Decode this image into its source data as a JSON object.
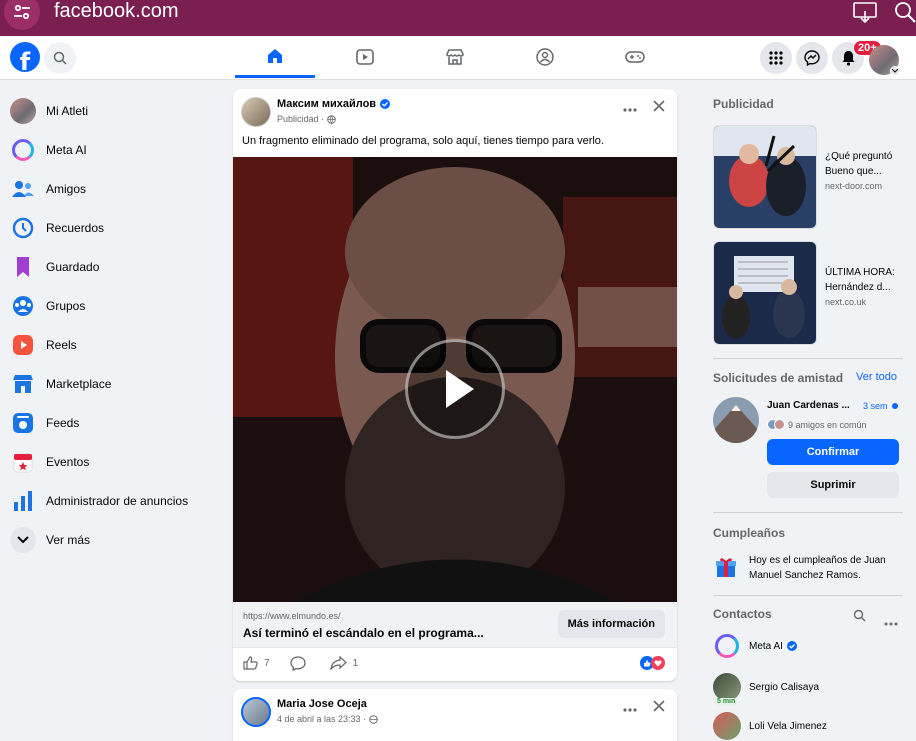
{
  "browser": {
    "url": "facebook.com",
    "icons": [
      "site-settings-icon",
      "cast-icon",
      "zoom-icon"
    ]
  },
  "header": {
    "logo_letter": "f",
    "nav_tabs": [
      {
        "name": "home",
        "icon": "home-icon",
        "active": true
      },
      {
        "name": "reels",
        "icon": "reels-icon",
        "active": false
      },
      {
        "name": "marketplace",
        "icon": "marketplace-icon",
        "active": false
      },
      {
        "name": "groups",
        "icon": "groups-icon",
        "active": false
      },
      {
        "name": "gaming",
        "icon": "gaming-icon",
        "active": false
      }
    ],
    "notifications_badge": "20+"
  },
  "sidebar": {
    "items": [
      {
        "label": "Mi Atleti",
        "icon": "profile-avatar-icon"
      },
      {
        "label": "Meta AI",
        "icon": "meta-ai-icon"
      },
      {
        "label": "Amigos",
        "icon": "friends-icon"
      },
      {
        "label": "Recuerdos",
        "icon": "memories-icon"
      },
      {
        "label": "Guardado",
        "icon": "saved-icon"
      },
      {
        "label": "Grupos",
        "icon": "groups-icon"
      },
      {
        "label": "Reels",
        "icon": "reels-icon"
      },
      {
        "label": "Marketplace",
        "icon": "marketplace-icon"
      },
      {
        "label": "Feeds",
        "icon": "feeds-icon"
      },
      {
        "label": "Eventos",
        "icon": "events-icon"
      },
      {
        "label": "Administrador de anuncios",
        "icon": "ads-manager-icon"
      },
      {
        "label": "Ver más",
        "icon": "chevron-down-icon"
      }
    ]
  },
  "post1": {
    "author": "Максим михайлов",
    "sub": "Publicidad ·",
    "text": "Un fragmento eliminado del programa, solo aquí, tienes tiempo para verlo.",
    "link_domain": "https://www.elmundo.es/",
    "link_title": "Así terminó el escándalo en el programa...",
    "cta": "Más información",
    "likes": "7",
    "shares": "1"
  },
  "post2": {
    "author": "Maria Jose Oceja",
    "sub": "4 de abril a las 23:33 ·"
  },
  "right": {
    "ads_heading": "Publicidad",
    "ads": [
      {
        "title": "¿Qué preguntó Bueno que...",
        "domain": "next-door.com"
      },
      {
        "title": "ÚLTIMA HORA: Hernández d...",
        "domain": "next.co.uk"
      }
    ],
    "friend_requests": {
      "heading": "Solicitudes de amistad",
      "see_all": "Ver todo",
      "name": "Juan Cardenas ...",
      "time": "3 sem",
      "mutual": "9 amigos en común",
      "confirm": "Confirmar",
      "delete": "Suprimir"
    },
    "birthdays": {
      "heading": "Cumpleaños",
      "text": "Hoy es el cumpleaños de Juan Manuel Sanchez Ramos."
    },
    "contacts": {
      "heading": "Contactos",
      "items": [
        {
          "name": "Meta AI",
          "verified": true
        },
        {
          "name": "Sergio Calisaya",
          "status": "5 min"
        },
        {
          "name": "Loli Vela Jimenez"
        }
      ]
    }
  },
  "colors": {
    "browser_bar": "#7a1f4f",
    "fb_blue": "#0866ff",
    "page_bg": "#f0f2f5",
    "badge_red": "#e41e3f"
  }
}
